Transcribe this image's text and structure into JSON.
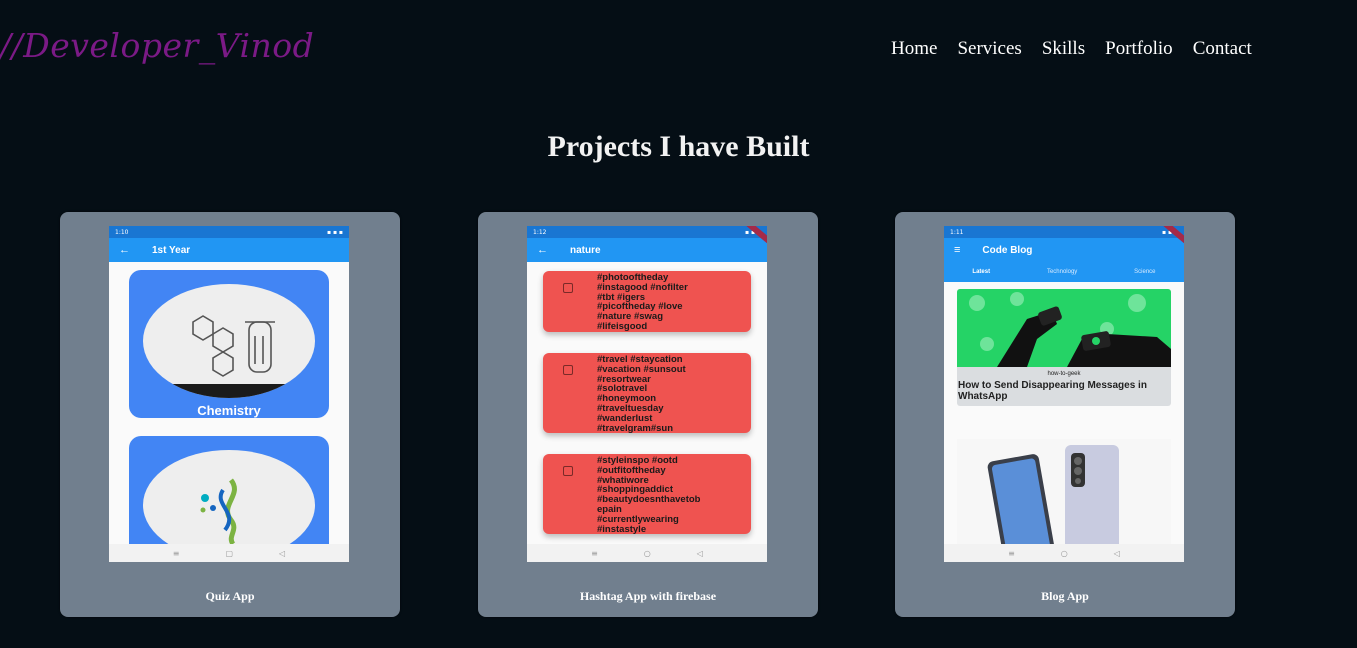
{
  "site": {
    "logo": "//Developer_Vinod"
  },
  "nav": [
    "Home",
    "Services",
    "Skills",
    "Portfolio",
    "Contact"
  ],
  "section_title": "Projects I have Built",
  "projects": [
    {
      "caption": "Quiz App",
      "screen": {
        "status_time": "1:10",
        "appbar_title": "1st Year",
        "tiles": [
          "Chemistry"
        ]
      }
    },
    {
      "caption": "Hashtag App with firebase",
      "screen": {
        "status_time": "1:12",
        "appbar_title": "nature",
        "cards": [
          "#photooftheday\n#instagood #nofilter\n#tbt #igers\n#picoftheday #love\n#nature #swag\n#lifeisgood",
          "#travel #staycation\n#vacation #sunsout\n#resortwear\n#solotravel\n#honeymoon\n#traveltuesday\n#wanderlust\n#travelgram#sun",
          "#styleinspo #ootd\n#outfitoftheday\n#whatiwore\n#shoppingaddict\n#beautydoesnthavetob\nepain\n#currentlywearing\n#instastyle"
        ]
      }
    },
    {
      "caption": "Blog App",
      "screen": {
        "status_time": "1:11",
        "appbar_title": "Code Blog",
        "tabs": [
          "Latest",
          "Technology",
          "Science"
        ],
        "post_source": "how-to-geek",
        "post_title": "How to Send Disappearing Messages in WhatsApp"
      }
    }
  ],
  "colors": {
    "background": "#050e15",
    "logo": "#7b1a86",
    "card": "#717f8e",
    "appbar": "#2196f3",
    "hashtag_card": "#ef5350",
    "whatsapp_green": "#25d366"
  }
}
